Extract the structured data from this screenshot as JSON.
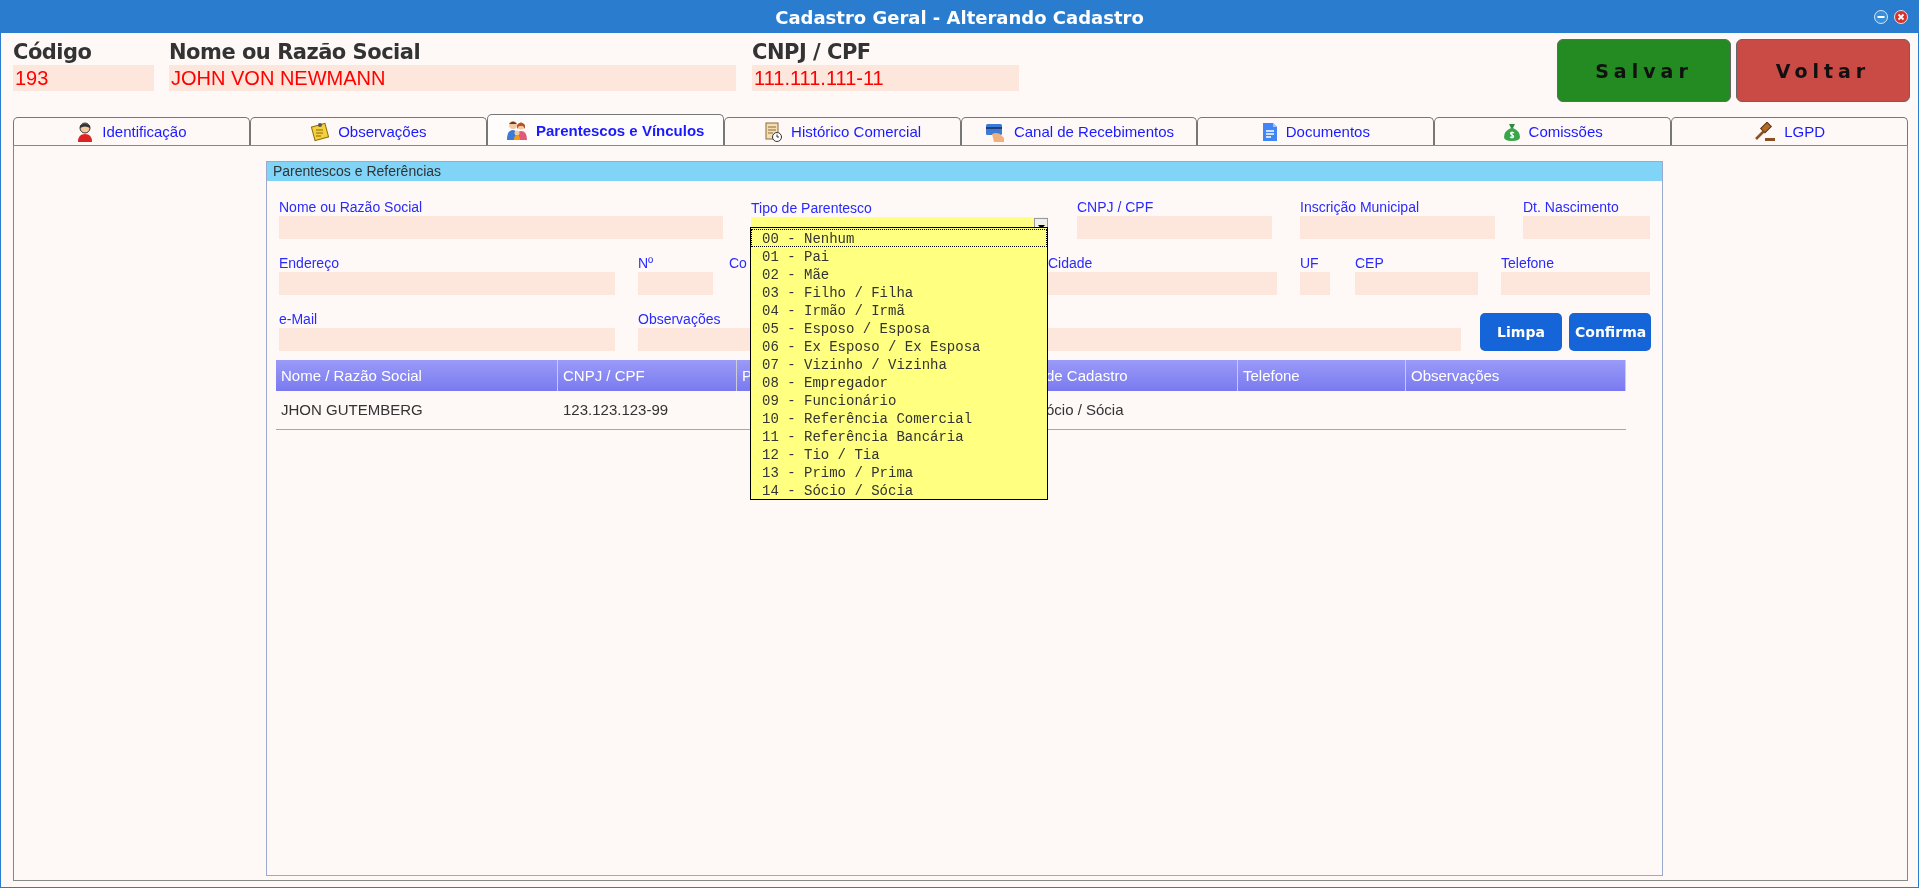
{
  "window": {
    "title": "Cadastro Geral - Alterando Cadastro"
  },
  "header": {
    "fields": [
      {
        "label": "Código",
        "value": "193"
      },
      {
        "label": "Nome ou Razão Social",
        "value": "JOHN VON NEWMANN"
      },
      {
        "label": "CNPJ / CPF",
        "value": "111.111.111-11"
      }
    ],
    "buttons": [
      {
        "label": "Salvar",
        "kind": "save"
      },
      {
        "label": "Voltar",
        "kind": "back"
      }
    ]
  },
  "tabs": [
    {
      "label": "Identificação",
      "selected": false
    },
    {
      "label": "Observações",
      "selected": false
    },
    {
      "label": "Parentescos e Vínculos",
      "selected": true
    },
    {
      "label": "Histórico Comercial",
      "selected": false
    },
    {
      "label": "Canal de Recebimentos",
      "selected": false
    },
    {
      "label": "Documentos",
      "selected": false
    },
    {
      "label": "Comissões",
      "selected": false
    },
    {
      "label": "LGPD",
      "selected": false
    }
  ],
  "group": {
    "title": "Parentescos e Referências",
    "fields": [
      {
        "label": "Nome ou Razão Social",
        "kind": "text"
      },
      {
        "label": "Tipo de Parentesco",
        "kind": "select"
      },
      {
        "label": "CNPJ / CPF",
        "kind": "text"
      },
      {
        "label": "Inscrição Municipal",
        "kind": "text"
      },
      {
        "label": "Dt. Nascimento",
        "kind": "text"
      },
      {
        "label": "Endereço",
        "kind": "text"
      },
      {
        "label": "Nº",
        "kind": "text"
      },
      {
        "label": "Co",
        "kind": "covered"
      },
      {
        "label": "Cidade",
        "kind": "text"
      },
      {
        "label": "UF",
        "kind": "text"
      },
      {
        "label": "CEP",
        "kind": "text"
      },
      {
        "label": "Telefone",
        "kind": "text"
      },
      {
        "label": "e-Mail",
        "kind": "text"
      },
      {
        "label": "Observações",
        "kind": "text"
      }
    ],
    "buttons": [
      "Limpa",
      "Confirma"
    ],
    "table": {
      "columns": [
        "Nome / Razão Social",
        "CNPJ / CPF",
        "P",
        "de Cadastro",
        "Telefone",
        "Observações"
      ],
      "rows": [
        {
          "cells": [
            "JHON GUTEMBERG",
            "123.123.123-99",
            null,
            "ócio / Sócia",
            null,
            null
          ]
        }
      ]
    },
    "dropdown": {
      "options": [
        {
          "label": "00 - Nenhum",
          "selected": true
        },
        {
          "label": "01 - Pai",
          "selected": false
        },
        {
          "label": "02 - Mãe",
          "selected": false
        },
        {
          "label": "03 - Filho / Filha",
          "selected": false
        },
        {
          "label": "04 - Irmão / Irmã",
          "selected": false
        },
        {
          "label": "05 - Esposo / Esposa",
          "selected": false
        },
        {
          "label": "06 - Ex Esposo / Ex Esposa",
          "selected": false
        },
        {
          "label": "07 - Vizinho / Vizinha",
          "selected": false
        },
        {
          "label": "08 - Empregador",
          "selected": false
        },
        {
          "label": "09 - Funcionário",
          "selected": false
        },
        {
          "label": "10 - Referência Comercial",
          "selected": false
        },
        {
          "label": "11 - Referência Bancária",
          "selected": false
        },
        {
          "label": "12 - Tio / Tia",
          "selected": false
        },
        {
          "label": "13 - Primo / Prima",
          "selected": false
        },
        {
          "label": "14 - Sócio / Sócia",
          "selected": false
        }
      ]
    }
  }
}
